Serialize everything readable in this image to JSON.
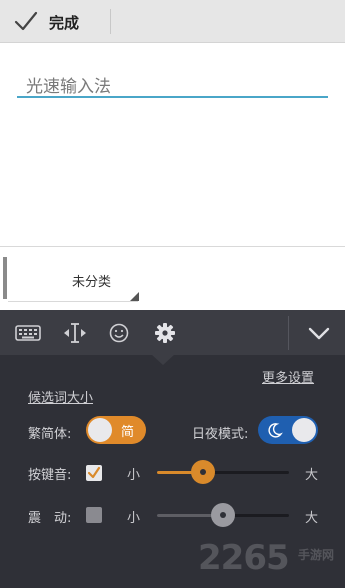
{
  "topbar": {
    "done_label": "完成"
  },
  "editor": {
    "text": "光速输入法"
  },
  "category": {
    "label": "未分类"
  },
  "toolbar": {
    "icons": [
      "keyboard-icon",
      "cursor-icon",
      "emoji-icon",
      "gear-icon"
    ],
    "collapse_icon": "chevron-down-icon"
  },
  "settings": {
    "more_link": "更多设置",
    "candidate_size_link": "候选词大小",
    "traditional": {
      "label": "繁简体:",
      "toggle_text": "简",
      "color": "#e08a2a"
    },
    "night_mode": {
      "label": "日夜模式:",
      "icon": "moon-icon",
      "color": "#1f5fb0"
    },
    "key_sound": {
      "label": "按键音:",
      "checked": true,
      "min_label": "小",
      "max_label": "大",
      "level": 0.35,
      "color": "#d98a2b"
    },
    "vibration": {
      "label": "震　动:",
      "checked": false,
      "min_label": "小",
      "max_label": "大",
      "level": 0.5
    }
  },
  "watermark": {
    "main": "2265",
    "sub": "手游网"
  }
}
